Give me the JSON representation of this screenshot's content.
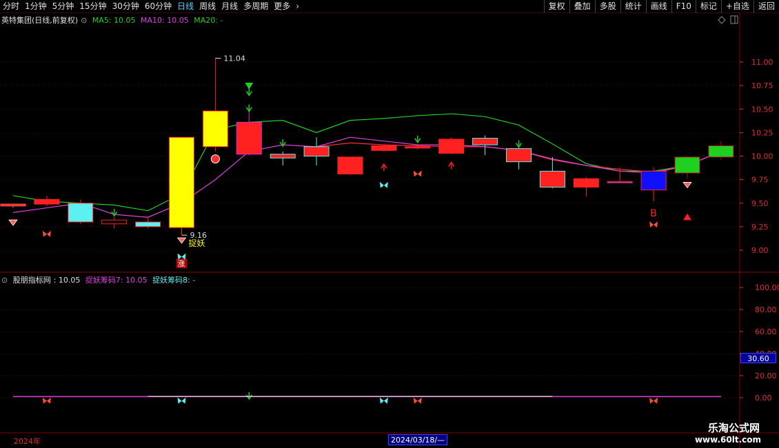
{
  "toolbar": {
    "left": [
      "分时",
      "1分钟",
      "5分钟",
      "15分钟",
      "30分钟",
      "60分钟",
      "日线",
      "周线",
      "月线",
      "多周期",
      "更多"
    ],
    "active": "日线",
    "right": [
      "复权",
      "叠加",
      "多股",
      "统计",
      "画线",
      "F10",
      "标记",
      "+自选",
      "返回"
    ]
  },
  "main_legend": {
    "title": "英特集团(日线,前复权)",
    "ma5": "MA5: 10.05",
    "ma10": "MA10: 10.05",
    "ma20": "MA20: -"
  },
  "sub_legend": {
    "name": "股朋指标网",
    "value": ": 10.05",
    "s7": "捉妖筹码7: 10.05",
    "s8": "捉妖筹码8: -"
  },
  "annotations": {
    "high_label": "11.04",
    "low_label": "9.16",
    "zhuoyao": "捉妖",
    "zhang": "涨",
    "b": "B"
  },
  "bottom": {
    "year": "2024年",
    "date": "2024/03/18/—",
    "value_box": "30.60"
  },
  "watermark": {
    "line1": "乐淘公式网",
    "line2": "www.60lt.com"
  },
  "colors": {
    "up": "#ff2020",
    "down_cyan": "#5cf0f0",
    "limit_up": "#ffff00",
    "ma5": "#e040e0",
    "ma10": "#ff3030",
    "ma20": "#20d020",
    "axis": "#e03030",
    "grid": "#5a0000"
  },
  "chart_data": {
    "type": "candlestick",
    "main": {
      "yticks": [
        11.0,
        10.75,
        10.5,
        10.25,
        10.0,
        9.75,
        9.5,
        9.25,
        9.0
      ],
      "yticklabels": [
        "11.00",
        "10.75",
        "10.50",
        "10.25",
        "10.00",
        "9.75",
        "9.50",
        "9.25",
        "9.00"
      ],
      "candles": [
        {
          "o": 9.47,
          "c": 9.49,
          "h": 9.49,
          "l": 9.45,
          "fill": "#ff2020",
          "edge": "#ff6060"
        },
        {
          "o": 9.49,
          "c": 9.54,
          "h": 9.58,
          "l": 9.47,
          "fill": "#ff2020",
          "edge": "#ff2020"
        },
        {
          "o": 9.5,
          "c": 9.3,
          "h": 9.54,
          "l": 9.28,
          "fill": "#5cf0f0",
          "edge": "#ff2020"
        },
        {
          "o": 9.28,
          "c": 9.32,
          "h": 9.35,
          "l": 9.23,
          "fill": "#000000",
          "edge": "#ff2020"
        },
        {
          "o": 9.3,
          "c": 9.25,
          "h": 9.36,
          "l": 9.23,
          "fill": "#5cf0f0",
          "edge": "#ff2020"
        },
        {
          "o": 9.24,
          "c": 10.2,
          "h": 10.2,
          "l": 9.16,
          "fill": "#ffff00",
          "edge": "#ff2020"
        },
        {
          "o": 10.1,
          "c": 10.48,
          "h": 11.04,
          "l": 10.05,
          "fill": "#ffff00",
          "edge": "#ff2020"
        },
        {
          "o": 10.36,
          "c": 10.02,
          "h": 10.55,
          "l": 10.01,
          "fill": "#ff2020",
          "edge": "#e020e0"
        },
        {
          "o": 10.02,
          "c": 9.98,
          "h": 10.05,
          "l": 9.9,
          "fill": "#ff2020",
          "edge": "#5cf0f0"
        },
        {
          "o": 10.1,
          "c": 10.0,
          "h": 10.2,
          "l": 9.9,
          "fill": "#ff2020",
          "edge": "#5cf0f0"
        },
        {
          "o": 9.81,
          "c": 9.99,
          "h": 9.99,
          "l": 9.8,
          "fill": "#ff2020",
          "edge": "#ff2020"
        },
        {
          "o": 10.06,
          "c": 10.11,
          "h": 10.13,
          "l": 10.05,
          "fill": "#ff2020",
          "edge": "#ff2020"
        },
        {
          "o": 10.09,
          "c": 10.1,
          "h": 10.13,
          "l": 10.07,
          "fill": "#ff2020",
          "edge": "#ff2020"
        },
        {
          "o": 10.03,
          "c": 10.18,
          "h": 10.2,
          "l": 10.02,
          "fill": "#ff2020",
          "edge": "#ff2020"
        },
        {
          "o": 10.19,
          "c": 10.12,
          "h": 10.22,
          "l": 10.01,
          "fill": "#ff2020",
          "edge": "#5cf0f0"
        },
        {
          "o": 10.08,
          "c": 9.94,
          "h": 10.1,
          "l": 9.86,
          "fill": "#ff2020",
          "edge": "#5cf0f0"
        },
        {
          "o": 9.84,
          "c": 9.67,
          "h": 9.99,
          "l": 9.66,
          "fill": "#ff2020",
          "edge": "#5cf0f0"
        },
        {
          "o": 9.67,
          "c": 9.76,
          "h": 9.78,
          "l": 9.57,
          "fill": "#ff2020",
          "edge": "#ff2020"
        },
        {
          "o": 9.72,
          "c": 9.73,
          "h": 9.88,
          "l": 9.72,
          "fill": "#3060ff",
          "edge": "#ff2020"
        },
        {
          "o": 9.64,
          "c": 9.84,
          "h": 9.88,
          "l": 9.52,
          "fill": "#1010ff",
          "edge": "#ff2020"
        },
        {
          "o": 9.82,
          "c": 9.99,
          "h": 10.0,
          "l": 9.76,
          "fill": "#20d020",
          "edge": "#b01010"
        },
        {
          "o": 9.99,
          "c": 10.11,
          "h": 10.16,
          "l": 9.96,
          "fill": "#20d020",
          "edge": "#b01010"
        }
      ],
      "ma5": [
        9.4,
        9.45,
        9.5,
        9.38,
        9.35,
        9.5,
        9.75,
        10.05,
        10.12,
        10.1,
        10.2,
        10.16,
        10.12,
        10.12,
        10.1,
        10.06,
        9.97,
        9.9,
        9.84,
        9.82,
        9.9,
        10.05
      ],
      "ma10": [
        null,
        null,
        null,
        null,
        null,
        null,
        null,
        null,
        null,
        10.1,
        10.14,
        10.12,
        10.11,
        10.1,
        10.1,
        10.06,
        9.96,
        9.9,
        9.86,
        9.83,
        9.9,
        10.05
      ],
      "ma20": [
        9.58,
        9.52,
        9.5,
        9.48,
        9.42,
        9.6,
        10.28,
        10.36,
        10.38,
        10.25,
        10.38,
        10.4,
        10.43,
        10.45,
        10.42,
        10.33,
        10.13,
        9.92,
        9.84,
        9.84,
        9.9,
        10.05
      ]
    },
    "sub": {
      "yticks": [
        100,
        80,
        60,
        40,
        20,
        0
      ],
      "yticklabels": [
        "100.00",
        "80.00",
        "60.00",
        "40.00",
        "20.00",
        "0.00"
      ],
      "line_value": 10.05
    }
  }
}
